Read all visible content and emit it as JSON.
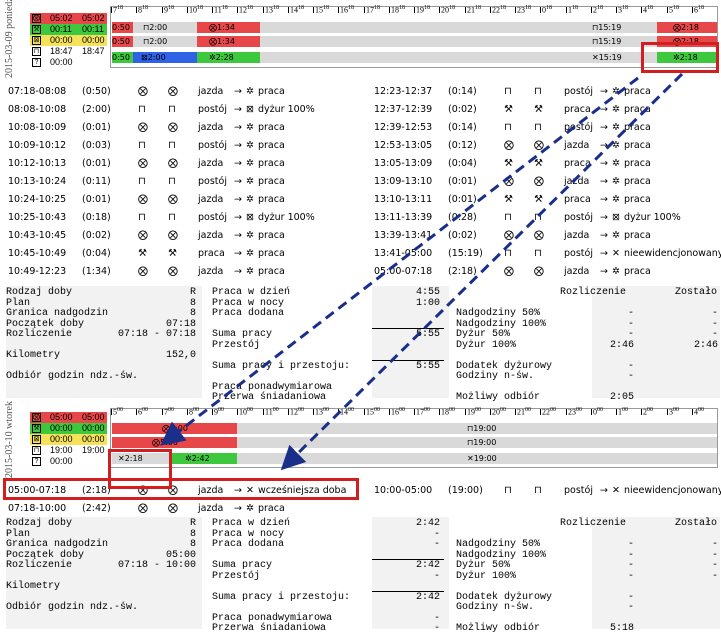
{
  "day1": {
    "date": "2015-03-09",
    "weekday": "poniedziałek",
    "legend": [
      {
        "icon": "circle-x",
        "a": "05:02",
        "b": "05:02",
        "color": "#e8474a"
      },
      {
        "icon": "hammer",
        "a": "00:11",
        "b": "00:11",
        "color": "#3ec83e"
      },
      {
        "icon": "box-x",
        "a": "00:00",
        "b": "00:00",
        "color": "#f5e25a"
      },
      {
        "icon": "bed",
        "a": "18:47",
        "b": "18:47",
        "color": "#ffffff"
      },
      {
        "icon": "question",
        "a": "00:00",
        "b": "",
        "color": "#ffffff"
      }
    ],
    "hours": [
      "7",
      "8",
      "9",
      "10",
      "11",
      "12",
      "13",
      "14",
      "15",
      "16",
      "17",
      "18",
      "19",
      "20",
      "21",
      "22",
      "23",
      "0",
      "1",
      "2",
      "3",
      "4",
      "5",
      "6"
    ],
    "hour_sup": "18",
    "bars": {
      "r1_left": "0:50",
      "r1_a": "2:00",
      "r1_b": "1:34",
      "r1_c": "15:19",
      "r1_d": "2:18",
      "r2_left": "0:50",
      "r2_a": "2:00",
      "r2_b": "1:34",
      "r2_c": "15:19",
      "r2_d": "2:18",
      "r3_left": "0:50",
      "r3_a": "2:00",
      "r3_b": "2:28",
      "r3_c": "15:19",
      "r3_d": "2:18"
    },
    "events_left": [
      {
        "time": "07:18-08:08",
        "dur": "(0:50)",
        "i1": "⨂",
        "i2": "⨂",
        "desc": "jazda",
        "to": "praca"
      },
      {
        "time": "08:08-10:08",
        "dur": "(2:00)",
        "i1": "⊓",
        "i2": "⊓",
        "desc": "postój",
        "to": "dyżur 100%"
      },
      {
        "time": "10:08-10:09",
        "dur": "(0:01)",
        "i1": "⨂",
        "i2": "⨂",
        "desc": "jazda",
        "to": "praca"
      },
      {
        "time": "10:09-10:12",
        "dur": "(0:03)",
        "i1": "⊓",
        "i2": "⊓",
        "desc": "postój",
        "to": "praca"
      },
      {
        "time": "10:12-10:13",
        "dur": "(0:01)",
        "i1": "⨂",
        "i2": "⨂",
        "desc": "jazda",
        "to": "praca"
      },
      {
        "time": "10:13-10:24",
        "dur": "(0:11)",
        "i1": "⊓",
        "i2": "⊓",
        "desc": "postój",
        "to": "praca"
      },
      {
        "time": "10:24-10:25",
        "dur": "(0:01)",
        "i1": "⨂",
        "i2": "⨂",
        "desc": "jazda",
        "to": "praca"
      },
      {
        "time": "10:25-10:43",
        "dur": "(0:18)",
        "i1": "⊓",
        "i2": "⊓",
        "desc": "postój",
        "to": "dyżur 100%"
      },
      {
        "time": "10:43-10:45",
        "dur": "(0:02)",
        "i1": "⨂",
        "i2": "⨂",
        "desc": "jazda",
        "to": "praca"
      },
      {
        "time": "10:45-10:49",
        "dur": "(0:04)",
        "i1": "⚒",
        "i2": "⚒",
        "desc": "praca",
        "to": "praca"
      },
      {
        "time": "10:49-12:23",
        "dur": "(1:34)",
        "i1": "⨂",
        "i2": "⨂",
        "desc": "jazda",
        "to": "praca"
      }
    ],
    "events_right": [
      {
        "time": "12:23-12:37",
        "dur": "(0:14)",
        "i1": "⊓",
        "i2": "⊓",
        "desc": "postój",
        "to": "praca"
      },
      {
        "time": "12:37-12:39",
        "dur": "(0:02)",
        "i1": "⚒",
        "i2": "⚒",
        "desc": "praca",
        "to": "praca"
      },
      {
        "time": "12:39-12:53",
        "dur": "(0:14)",
        "i1": "⊓",
        "i2": "⊓",
        "desc": "postój",
        "to": "praca"
      },
      {
        "time": "12:53-13:05",
        "dur": "(0:12)",
        "i1": "⨂",
        "i2": "⨂",
        "desc": "jazda",
        "to": "praca"
      },
      {
        "time": "13:05-13:09",
        "dur": "(0:04)",
        "i1": "⚒",
        "i2": "⚒",
        "desc": "praca",
        "to": "praca"
      },
      {
        "time": "13:09-13:10",
        "dur": "(0:01)",
        "i1": "⨂",
        "i2": "⨂",
        "desc": "jazda",
        "to": "praca"
      },
      {
        "time": "13:10-13:11",
        "dur": "(0:01)",
        "i1": "⚒",
        "i2": "⚒",
        "desc": "praca",
        "to": "praca"
      },
      {
        "time": "13:11-13:39",
        "dur": "(0:28)",
        "i1": "⊓",
        "i2": "⊓",
        "desc": "postój",
        "to": "dyżur 100%"
      },
      {
        "time": "13:39-13:41",
        "dur": "(0:02)",
        "i1": "⨂",
        "i2": "⨂",
        "desc": "jazda",
        "to": "praca"
      },
      {
        "time": "13:41-05:00",
        "dur": "(15:19)",
        "i1": "⊓",
        "i2": "⊓",
        "desc": "postój",
        "to": "nieewidencjonowany"
      },
      {
        "time": "05:00-07:18",
        "dur": "(2:18)",
        "i1": "⨂",
        "i2": "⨂",
        "desc": "jazda",
        "to": "praca"
      }
    ],
    "summary": {
      "left_labels": [
        "Rodzaj doby",
        "Plan",
        "Granica nadgodzin",
        "Początek doby",
        "Rozliczenie",
        "",
        "Kilometry",
        "",
        "Odbiór godzin ndz.-św."
      ],
      "left_values": [
        "R",
        "8",
        "8",
        "07:18",
        "07:18 - 07:18",
        "",
        "152,0",
        "",
        ""
      ],
      "mid_labels": [
        "Praca w dzień",
        "Praca w nocy",
        "Praca dodana",
        "",
        "Suma pracy",
        "Przestój",
        "",
        "Suma pracy i przestoju:",
        "",
        "Praca ponadwymiarowa",
        "Przerwa śniadaniowa"
      ],
      "mid_values": [
        "4:55",
        "1:00",
        "",
        "",
        "5:55",
        "",
        "",
        "5:55",
        "",
        "",
        ""
      ],
      "right_header_a": "Rozliczenie",
      "right_header_b": "Zostało",
      "right_labels": [
        "Nadgodziny 50%",
        "Nadgodziny 100%",
        "Dyżur 50%",
        "Dyżur 100%",
        "",
        "Dodatek dyżurowy",
        "Godziny n-św.",
        "",
        "Możliwy odbiór"
      ],
      "right_a": [
        "-",
        "-",
        "-",
        "2:46",
        "",
        "-",
        "-",
        "",
        "2:05"
      ],
      "right_b": [
        "-",
        "-",
        "-",
        "2:46",
        "",
        "",
        "",
        "",
        ""
      ]
    }
  },
  "day2": {
    "date": "2015-03-10",
    "weekday": "wtorek",
    "legend": [
      {
        "icon": "circle-x",
        "a": "05:00",
        "b": "05:00",
        "color": "#e8474a"
      },
      {
        "icon": "hammer",
        "a": "00:00",
        "b": "00:00",
        "color": "#3ec83e"
      },
      {
        "icon": "box-x",
        "a": "00:00",
        "b": "00:00",
        "color": "#f5e25a"
      },
      {
        "icon": "bed",
        "a": "19:00",
        "b": "19:00",
        "color": "#ffffff"
      },
      {
        "icon": "question",
        "a": "00:00",
        "b": "",
        "color": "#ffffff"
      }
    ],
    "hours": [
      "5",
      "6",
      "7",
      "8",
      "9",
      "10",
      "11",
      "12",
      "13",
      "14",
      "15",
      "16",
      "17",
      "18",
      "19",
      "20",
      "21",
      "22",
      "23",
      "0",
      "1",
      "2",
      "3",
      "4"
    ],
    "hour_sup": "00",
    "bars": {
      "r1_a": "5:00",
      "r1_c": "19:00",
      "r2_a": "5:00",
      "r2_c": "19:00",
      "r3_a": "2:18",
      "r3_b": "2:42",
      "r3_c": "19:00"
    },
    "events_left": [
      {
        "time": "05:00-07:18",
        "dur": "(2:18)",
        "i1": "⨂",
        "i2": "⨂",
        "desc": "jazda",
        "to": "wcześniejsza doba"
      },
      {
        "time": "07:18-10:00",
        "dur": "(2:42)",
        "i1": "⨂",
        "i2": "⨂",
        "desc": "jazda",
        "to": "praca"
      }
    ],
    "events_right": [
      {
        "time": "10:00-05:00",
        "dur": "(19:00)",
        "i1": "⊓",
        "i2": "⊓",
        "desc": "postój",
        "to": "nieewidencjonowany"
      }
    ],
    "summary": {
      "left_labels": [
        "Rodzaj doby",
        "Plan",
        "Granica nadgodzin",
        "Początek doby",
        "Rozliczenie",
        "",
        "Kilometry",
        "",
        "Odbiór godzin ndz.-św."
      ],
      "left_values": [
        "R",
        "8",
        "8",
        "05:00",
        "07:18 - 10:00",
        "",
        "",
        "",
        ""
      ],
      "mid_labels": [
        "Praca w dzień",
        "Praca w nocy",
        "Praca dodana",
        "",
        "Suma pracy",
        "Przestój",
        "",
        "Suma pracy i przestoju:",
        "",
        "Praca ponadwymiarowa",
        "Przerwa śniadaniowa"
      ],
      "mid_values": [
        "2:42",
        "-",
        "-",
        "",
        "2:42",
        "-",
        "",
        "2:42",
        "",
        "-",
        "-"
      ],
      "right_header_a": "Rozliczenie",
      "right_header_b": "Zostało",
      "right_labels": [
        "Nadgodziny 50%",
        "Nadgodziny 100%",
        "Dyżur 50%",
        "Dyżur 100%",
        "",
        "Dodatek dyżurowy",
        "Godziny n-św.",
        "",
        "Możliwy odbiór"
      ],
      "right_a": [
        "-",
        "-",
        "-",
        "-",
        "",
        "-",
        "-",
        "",
        "5:18"
      ],
      "right_b": [
        "-",
        "-",
        "-",
        "-",
        "",
        "",
        "",
        "",
        ""
      ]
    }
  },
  "colors": {
    "drive": "#e8474a",
    "work": "#3ec83e",
    "duty": "#2f62e6",
    "rest": "#d9d9d9",
    "highlight": "#d11e1e",
    "arrow": "#1a2f8a"
  }
}
